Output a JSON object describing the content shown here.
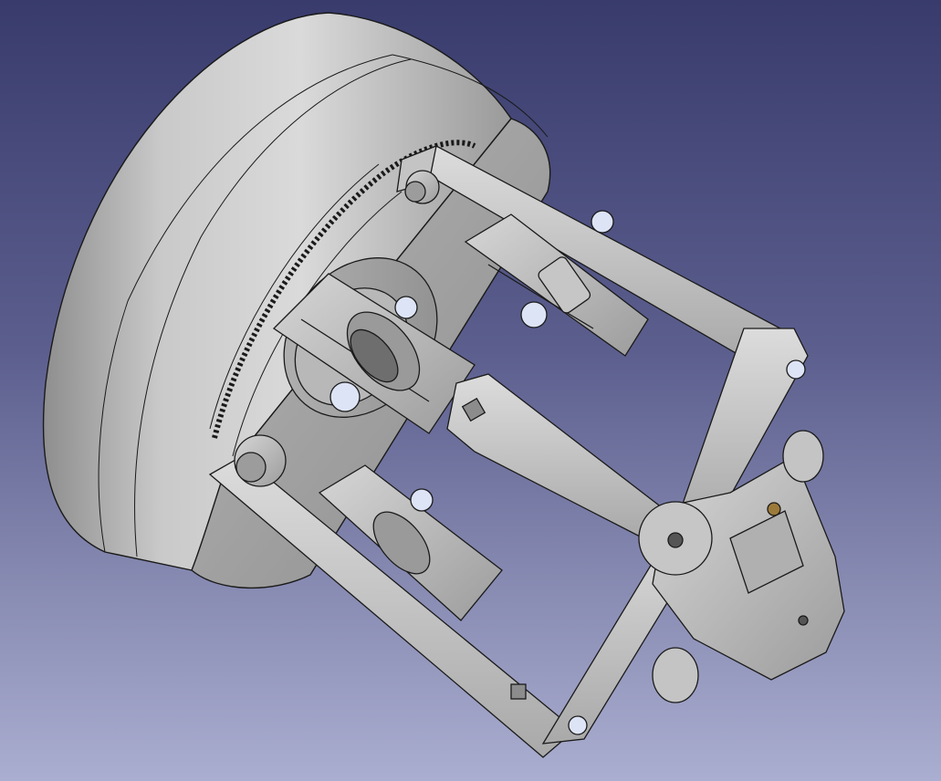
{
  "viewport": {
    "background_top": "#383b6c",
    "background_bottom": "#aaaed0",
    "model_color": "#c8c8c8",
    "edge_color": "#1a1a1a",
    "pin_color": "#dde4f6"
  }
}
